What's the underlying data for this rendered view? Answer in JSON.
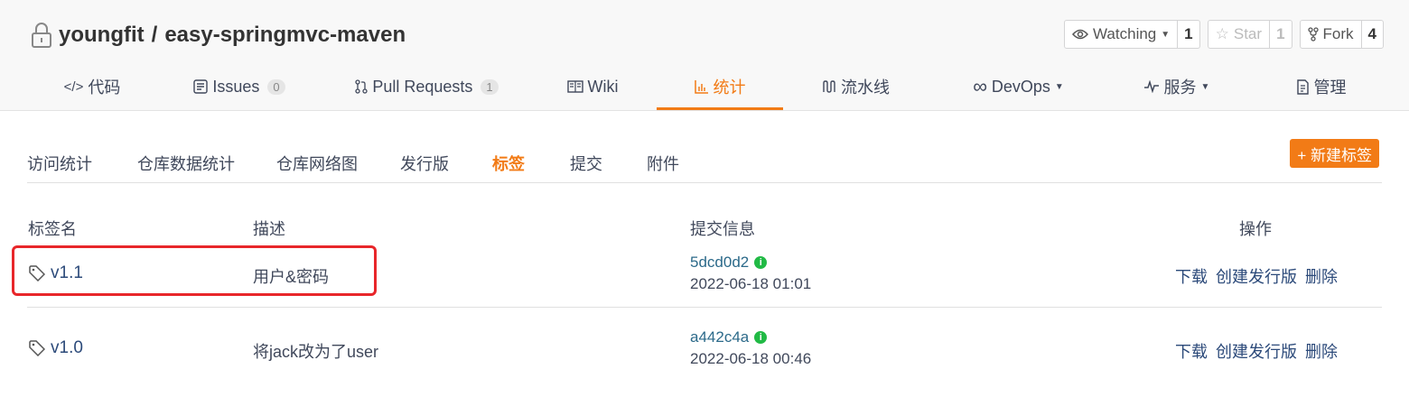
{
  "repo": {
    "owner": "youngfit",
    "separator": "/",
    "name": "easy-springmvc-maven"
  },
  "actions": {
    "watch": {
      "label": "Watching",
      "count": "1"
    },
    "star": {
      "label": "Star",
      "count": "1"
    },
    "fork": {
      "label": "Fork",
      "count": "4"
    }
  },
  "tabs": [
    {
      "label": "代码",
      "icon": "code-icon"
    },
    {
      "label": "Issues",
      "badge": "0",
      "icon": "issues-icon"
    },
    {
      "label": "Pull Requests",
      "badge": "1",
      "icon": "pull-request-icon"
    },
    {
      "label": "Wiki",
      "icon": "book-icon"
    },
    {
      "label": "统计",
      "icon": "bar-chart-icon",
      "active": true
    },
    {
      "label": "流水线",
      "icon": "pipeline-icon"
    },
    {
      "label": "DevOps",
      "icon": "infinity-icon"
    },
    {
      "label": "服务",
      "icon": "pulse-icon"
    },
    {
      "label": "管理",
      "icon": "settings-doc-icon"
    }
  ],
  "subnav": [
    "访问统计",
    "仓库数据统计",
    "仓库网络图",
    "发行版",
    "标签",
    "提交",
    "附件"
  ],
  "new_tag_button": "+ 新建标签",
  "columns": {
    "name": "标签名",
    "desc": "描述",
    "commit": "提交信息",
    "ops": "操作"
  },
  "tags": [
    {
      "name": "v1.1",
      "desc": "用户&密码",
      "sha": "5dcd0d2",
      "time": "2022-06-18 01:01",
      "ops": [
        "下载",
        "创建发行版",
        "删除"
      ]
    },
    {
      "name": "v1.0",
      "desc": "将jack改为了user",
      "sha": "a442c4a",
      "time": "2022-06-18 00:46",
      "ops": [
        "下载",
        "创建发行版",
        "删除"
      ]
    }
  ],
  "colors": {
    "accent": "#f27b16",
    "highlight": "#e8262a",
    "link": "#2c4a7a",
    "verified": "#21ba45"
  }
}
